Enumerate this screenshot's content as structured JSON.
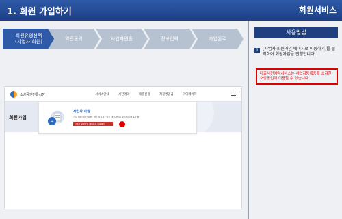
{
  "header": {
    "title": "1. 회원 가입하기",
    "service": "회원서비스"
  },
  "steps": [
    {
      "label": "회원유형선택\n(사업자 회원)",
      "state": "active"
    },
    {
      "label": "약관동의",
      "state": "inactive"
    },
    {
      "label": "사업자인증",
      "state": "inactive"
    },
    {
      "label": "정보입력",
      "state": "inactive"
    },
    {
      "label": "가입완료",
      "state": "inactive"
    }
  ],
  "site": {
    "logo_text": "소상공인전통시장",
    "menu": [
      "서비스안내",
      "사전예약",
      "대출신청",
      "제공영업금",
      "마이페이지"
    ],
    "page_title": "회원가입",
    "card": {
      "title": "사업자 회원",
      "desc": "가입 대상: 법인 대표, 개인 사업자 / 법인 대표자등록 및 사업자등록자 등",
      "button": "사업자 회원가입 페이지로 이동하기"
    }
  },
  "sidebar": {
    "heading": "사용방법",
    "step_number": "1",
    "instruction": "[사업자 회원가입 페이지로 이동하기]를 클릭하여 회원가입을 진행합니다.",
    "note": "대출사전예약서비스는 사업자등록증을 소지한 소상공인이 이용할 수 있습니다."
  },
  "colors": {
    "accent": "#2f5aa8",
    "highlight": "#e00000",
    "step_inactive": "#b7c2d1"
  }
}
